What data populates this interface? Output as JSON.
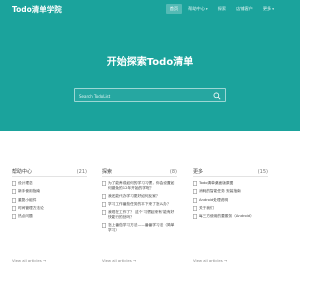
{
  "header": {
    "logo": "Todo清单学院",
    "nav": [
      {
        "label": "首页",
        "active": true
      },
      {
        "label": "帮助中心",
        "dropdown": true
      },
      {
        "label": "探索"
      },
      {
        "label": "店铺客户"
      },
      {
        "label": "更多",
        "dropdown": true
      }
    ]
  },
  "hero": {
    "title": "开始探索Todo清单",
    "search_placeholder": "Search TodoList",
    "icon": "search-icon"
  },
  "columns": [
    {
      "title": "帮助中心",
      "count": "(21)",
      "items": [
        "设计理念",
        "新手使用指南",
        "重复小组件",
        "时间管理方法论",
        "热点问题"
      ],
      "more": "View all articles →"
    },
    {
      "title": "探索",
      "count": "(8)",
      "items": [
        "为了能养成如何的学习习惯，你会设置如何避免的12年开始的学呢？",
        "我还能代办学习更好如何反家？",
        "学习工作番茄任务的平下来了怎么办？",
        "我现在工作了？ 这个‘习惯起来有’能有好快能行的处吗？",
        "怎上番茄学习方法——番番学习法（简单学习）"
      ],
      "more": "View all articles →"
    },
    {
      "title": "更多",
      "count": "(15)",
      "items": [
        "Todo清单桌面版原图",
        "消耗的智能任务 安装指南",
        "Android处理说明",
        "关于我们",
        "每三方使用的要服务（Android）"
      ],
      "more": "View all articles →"
    }
  ],
  "colors": {
    "hero_bg": "#1ba39c",
    "text": "#444444"
  }
}
